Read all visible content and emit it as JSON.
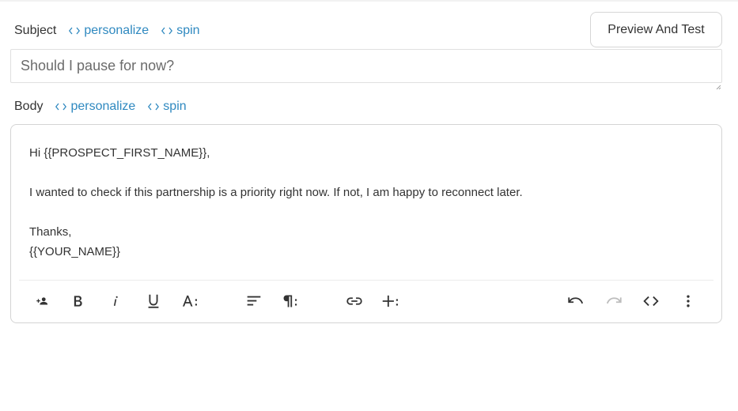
{
  "subject": {
    "label": "Subject",
    "personalize": "personalize",
    "spin": "spin",
    "value": "Should I pause for now?"
  },
  "preview_button": "Preview And Test",
  "body": {
    "label": "Body",
    "personalize": "personalize",
    "spin": "spin",
    "lines": [
      "Hi {{PROSPECT_FIRST_NAME}},",
      "",
      "I wanted to check if this partnership is a priority right now. If not, I am happy to reconnect later.",
      "",
      "Thanks,",
      "{{YOUR_NAME}}"
    ]
  },
  "toolbar": {
    "icons": [
      "add-person-icon",
      "bold-icon",
      "italic-icon",
      "underline-icon",
      "font-size-icon",
      "align-icon",
      "paragraph-icon",
      "link-icon",
      "insert-more-icon",
      "undo-icon",
      "redo-icon",
      "code-view-icon",
      "more-vertical-icon"
    ]
  },
  "colors": {
    "link": "#2f89c0",
    "text": "#333333",
    "border": "#d4d4d4",
    "icon": "#333333",
    "icon_disabled": "#bdbdbd"
  }
}
